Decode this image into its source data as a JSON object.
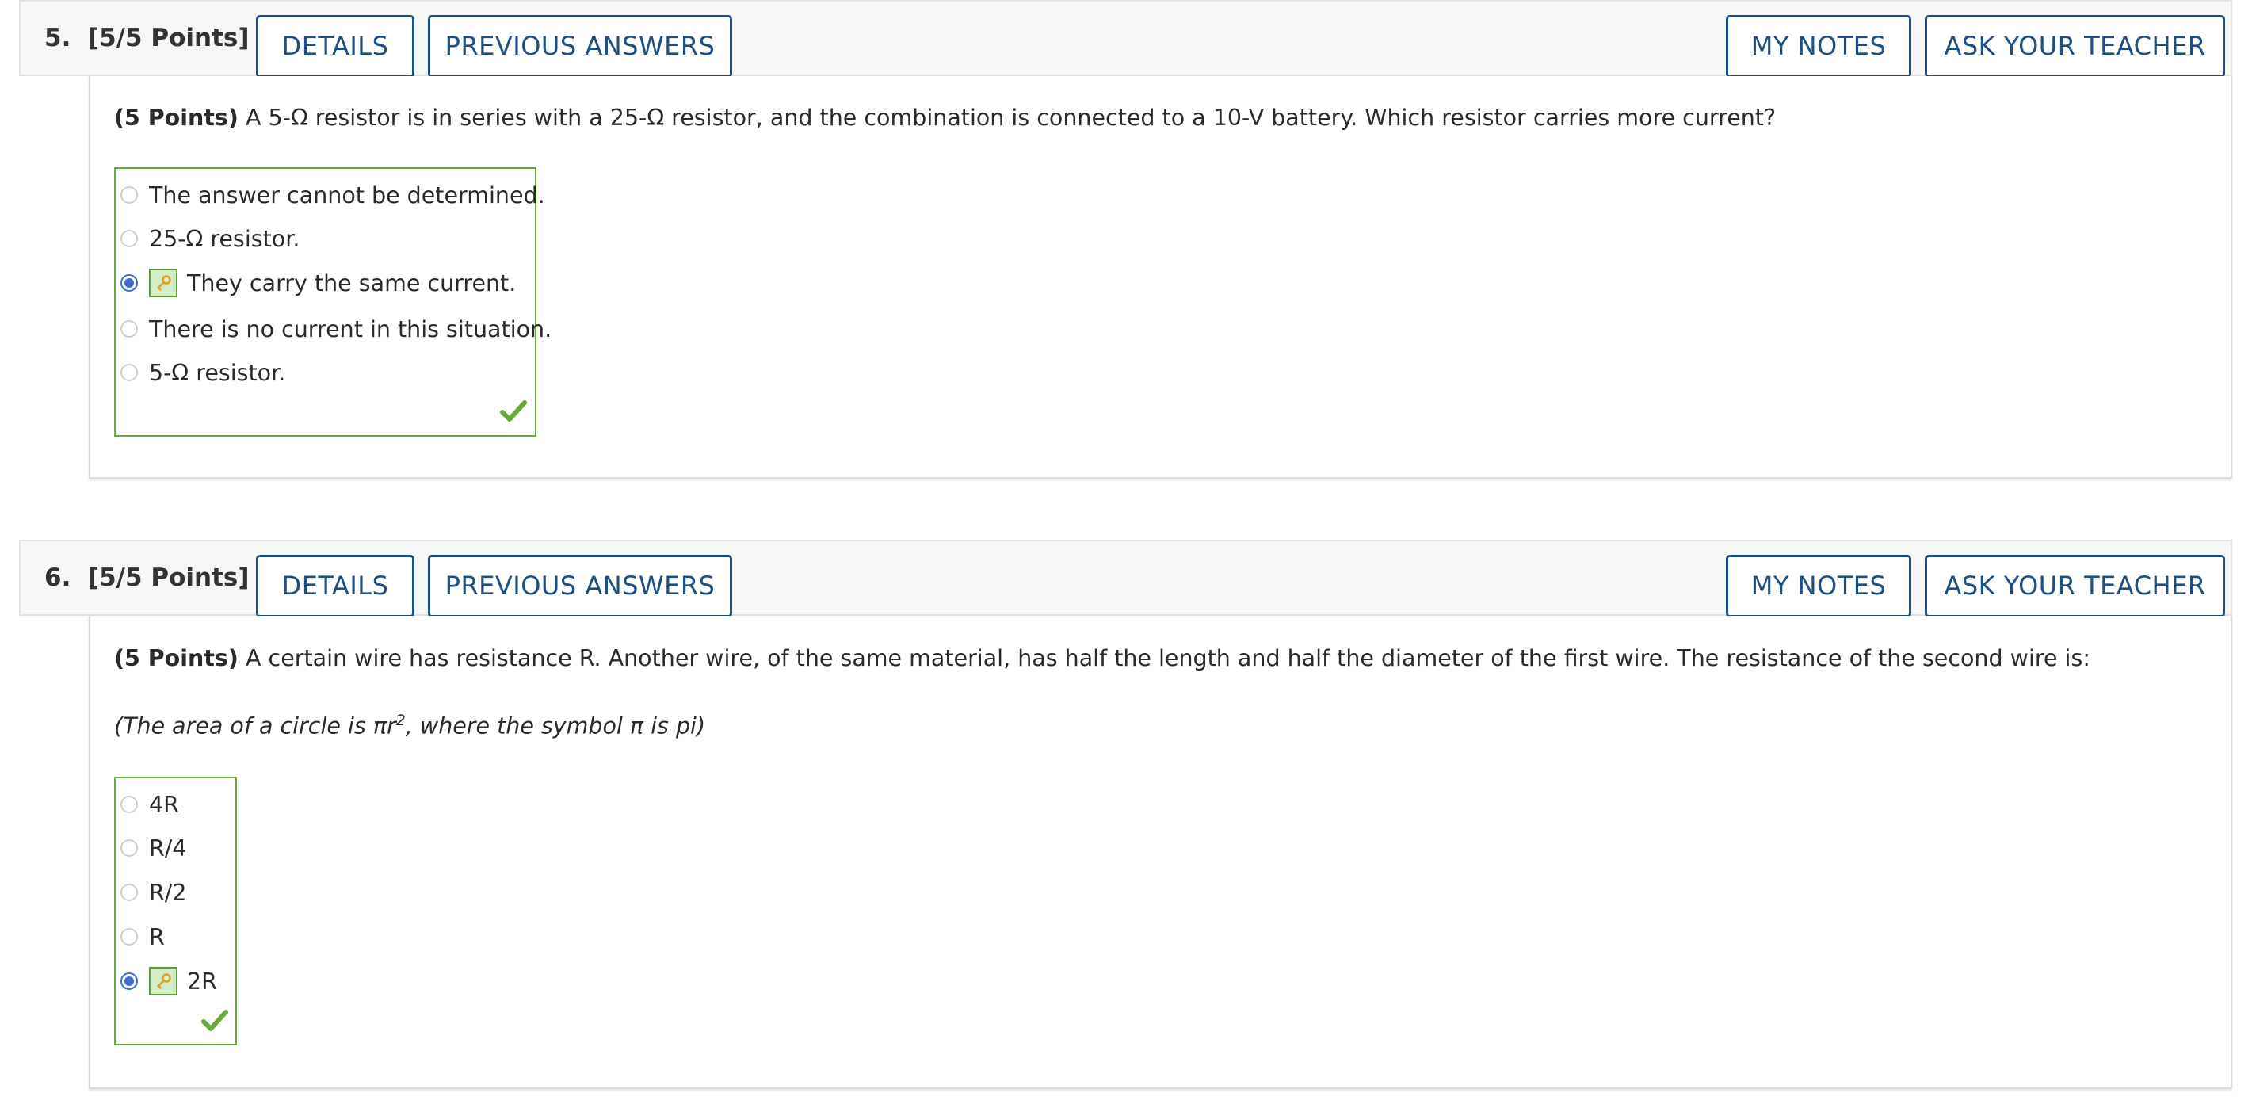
{
  "questions": [
    {
      "label": "5.  [5/5 Points]",
      "buttons": {
        "details": "DETAILS",
        "previous_answers": "PREVIOUS ANSWERS",
        "my_notes": "MY NOTES",
        "ask_teacher": "ASK YOUR TEACHER"
      },
      "points_prefix": "(5 Points)",
      "prompt": " A 5-Ω resistor is in series with a 25-Ω resistor, and the combination is connected to a 10-V battery. Which resistor carries more current?",
      "choices": [
        {
          "text": "The answer cannot be determined.",
          "selected": false
        },
        {
          "text": "25-Ω resistor.",
          "selected": false
        },
        {
          "text": "They carry the same current.",
          "selected": true
        },
        {
          "text": "There is no current in this situation.",
          "selected": false
        },
        {
          "text": "5-Ω resistor.",
          "selected": false
        }
      ]
    },
    {
      "label": "6.  [5/5 Points]",
      "buttons": {
        "details": "DETAILS",
        "previous_answers": "PREVIOUS ANSWERS",
        "my_notes": "MY NOTES",
        "ask_teacher": "ASK YOUR TEACHER"
      },
      "points_prefix": "(5 Points)",
      "prompt": " A certain wire has resistance R. Another wire, of the same material, has half the length and half the diameter of the first wire. The resistance of the second wire is:",
      "note_before": "(The area of a circle is πr",
      "note_sup": "2",
      "note_after": ", where the symbol π is pi)",
      "choices": [
        {
          "text": "4R",
          "selected": false
        },
        {
          "text": "R/4",
          "selected": false
        },
        {
          "text": "R/2",
          "selected": false
        },
        {
          "text": "R",
          "selected": false
        },
        {
          "text": "2R",
          "selected": true
        }
      ]
    }
  ],
  "icons": {
    "correct": "checkmark-icon",
    "key": "key-icon"
  },
  "colors": {
    "button_blue": "#1d4f83",
    "correct_green": "#6aaa3a",
    "radio_blue": "#3b6fd6"
  }
}
